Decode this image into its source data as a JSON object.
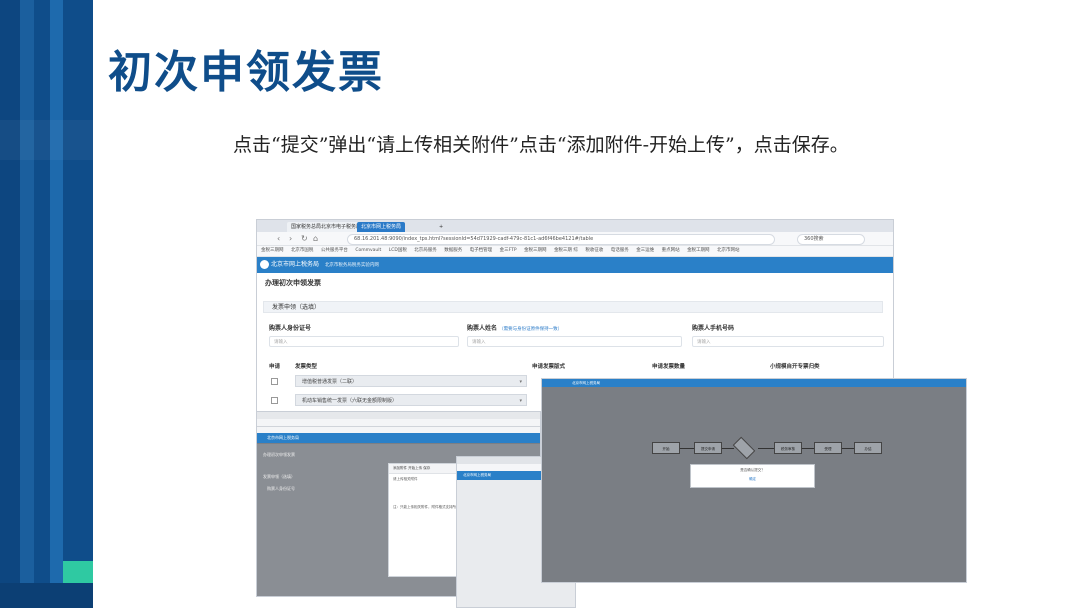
{
  "slide": {
    "title": "初次申领发票",
    "description": "点击“提交”弹出“请上传相关附件”点击“添加附件-开始上传”，点击保存。"
  },
  "colors": {
    "sidebar": "#0f4d8a",
    "accent": "#2fc9a2",
    "app_header": "#2a80c8",
    "title_text": "#0f4d8a"
  },
  "screenshot_main": {
    "tabs": [
      "国家税务总局北京市电子税务局",
      "北京市网上税务局",
      "+"
    ],
    "url": "68.16.201.48:9090/index_tps.html?sessionId=54d71929-cadf-479c-81c1-ad6f46be4121#/table",
    "search": "360搜索",
    "bookmarks": [
      "金税三期网",
      "北京市国税",
      "公共服务平台",
      "Commvault",
      "LCD国税",
      "北京局服务",
      "数据服务",
      "电子档管理",
      "金三FTP",
      "金税三期网",
      "金税三期 综",
      "税收征收",
      "电话服务",
      "金三运维",
      "重点网站",
      "金税工期网",
      "北京市网站"
    ],
    "app_title": "北京市网上税务局",
    "app_subtitle": "北京市税务局税务实验内网",
    "page_title": "办理初次申领发票",
    "panel_title": "发票申领（选填）",
    "fields": {
      "buyer_id_label": "购票人身份证号",
      "buyer_id_placeholder": "请输入",
      "buyer_name_label": "购票人姓名",
      "buyer_name_link": "（需要与身份证原件保持一致）",
      "buyer_name_placeholder": "请输入",
      "buyer_phone_label": "购票人手机号码",
      "buyer_phone_placeholder": "请输入"
    },
    "table": {
      "headers": [
        "申请",
        "发票类型",
        "申请发票版式",
        "申请发票数量",
        "小规模自开专票归类"
      ],
      "rows": [
        {
          "type": "增值税普通发票（二联）"
        },
        {
          "type": "机动车销售统一发票（六联无金额限制版）"
        }
      ]
    }
  },
  "screenshot_dialog": {
    "tabs": [
      "添加附件",
      "开始上传",
      "保存"
    ],
    "hint": "请上传相关附件",
    "note": "注：只能上传相关附件，附件格式支持所有"
  },
  "screenshot_flow": {
    "header": "北京市网上税务局",
    "steps": [
      "开始",
      "提交申请",
      "税务审核",
      "受理",
      "办结"
    ],
    "alert_text": "是否确认提交？",
    "alert_button": "确定"
  }
}
